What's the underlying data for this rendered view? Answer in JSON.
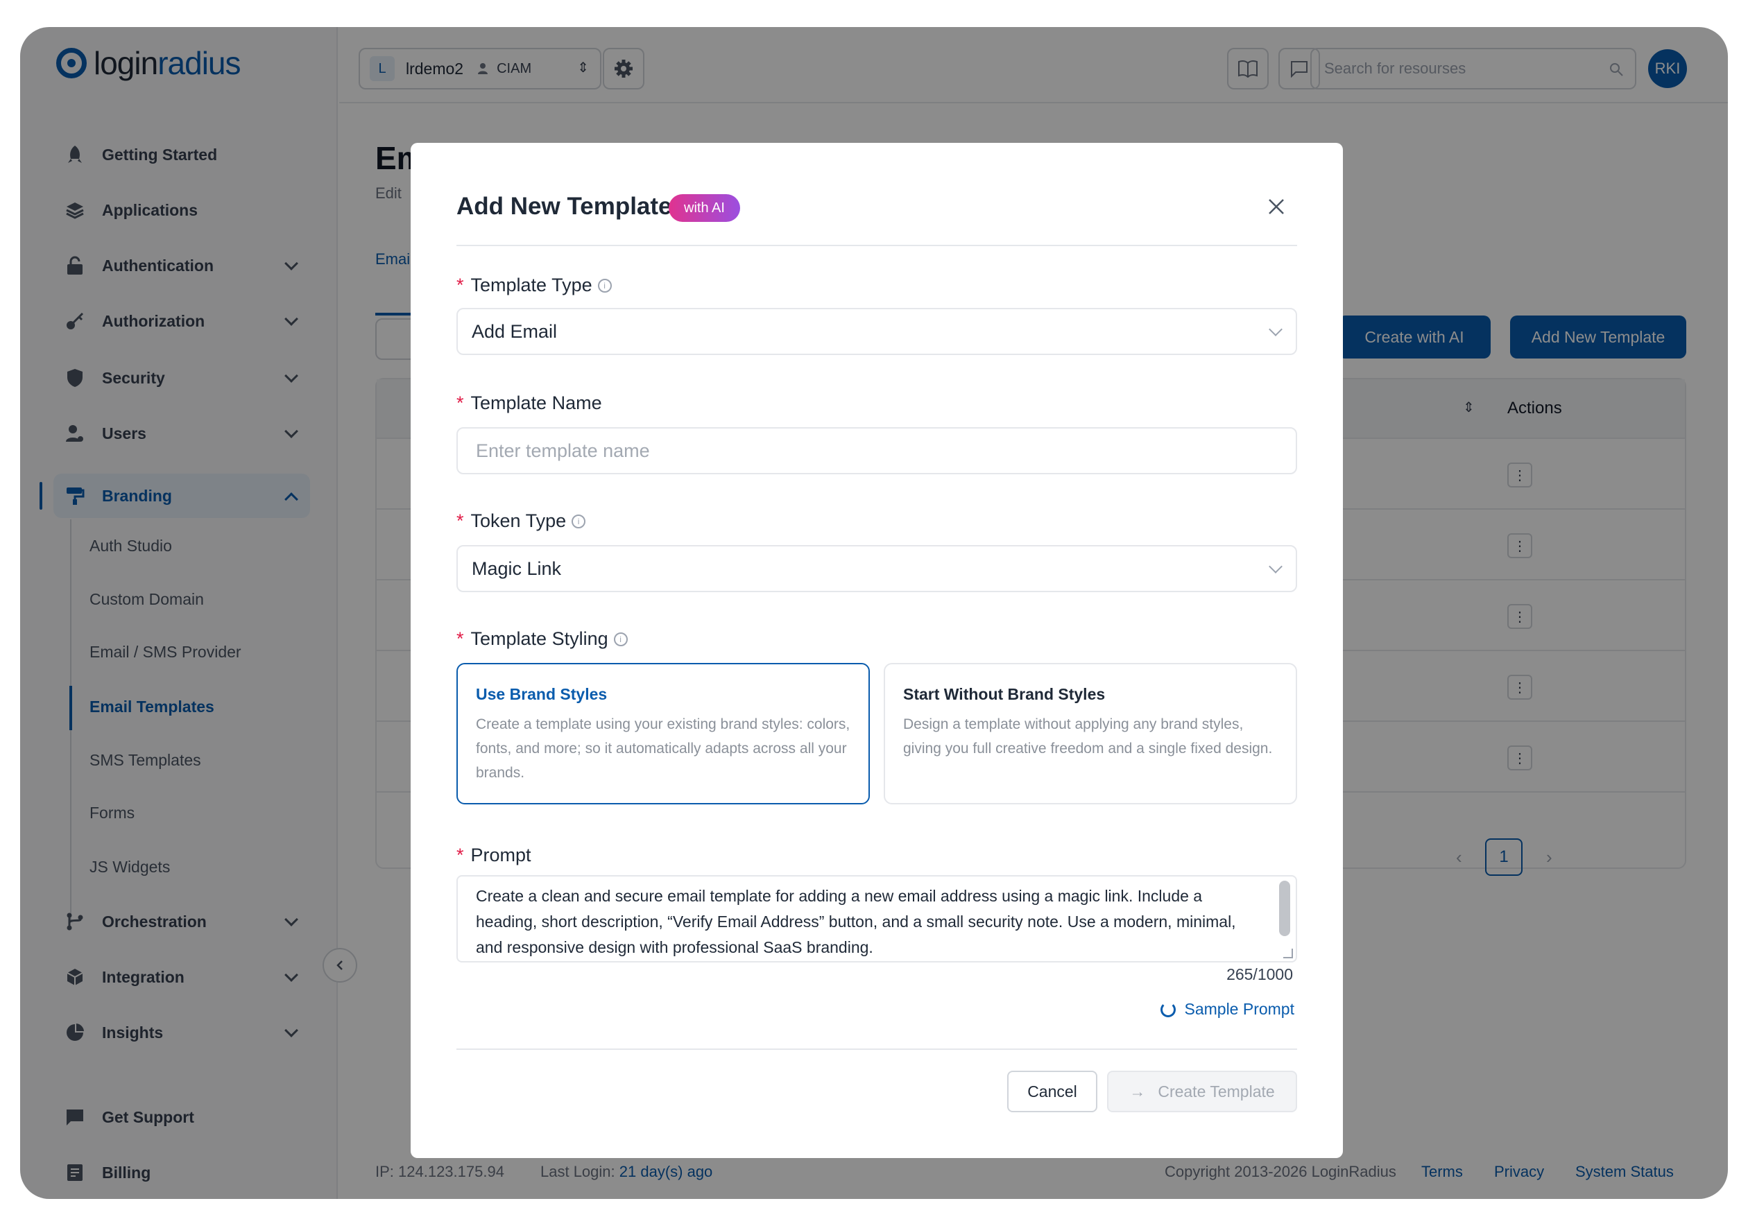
{
  "brand": {
    "logo_part1": "login",
    "logo_part2": "radius"
  },
  "sidebar": {
    "items": [
      {
        "label": "Getting Started",
        "icon": "rocket-icon"
      },
      {
        "label": "Applications",
        "icon": "layers-icon"
      },
      {
        "label": "Authentication",
        "icon": "lock-icon"
      },
      {
        "label": "Authorization",
        "icon": "key-icon"
      },
      {
        "label": "Security",
        "icon": "shield-icon"
      },
      {
        "label": "Users",
        "icon": "users-icon"
      },
      {
        "label": "Branding",
        "icon": "paint-roller-icon"
      },
      {
        "label": "Orchestration",
        "icon": "flow-icon"
      },
      {
        "label": "Integration",
        "icon": "cube-icon"
      },
      {
        "label": "Insights",
        "icon": "pie-chart-icon"
      },
      {
        "label": "Get Support",
        "icon": "chat-icon"
      },
      {
        "label": "Billing",
        "icon": "receipt-icon"
      }
    ],
    "branding_sub": [
      "Auth Studio",
      "Custom Domain",
      "Email / SMS Provider",
      "Email Templates",
      "SMS Templates",
      "Forms",
      "JS Widgets"
    ]
  },
  "topbar": {
    "env_initial": "L",
    "env_name": "lrdemo2",
    "env_role": "CIAM",
    "search_placeholder": "Search for resourses",
    "avatar": "RKI"
  },
  "page": {
    "title": "Em",
    "subtitle": "Edit",
    "tab": "Emai",
    "btn_ai": "Create with AI",
    "btn_add": "Add New Template",
    "col_actions": "Actions",
    "page_number": "1"
  },
  "footer": {
    "ip": "IP: 124.123.175.94",
    "last_login_label": "Last Login:",
    "last_login_value": "21 day(s) ago",
    "copyright": "Copyright 2013-2026 LoginRadius",
    "terms": "Terms",
    "privacy": "Privacy",
    "status": "System Status"
  },
  "modal": {
    "title": "Add New Template",
    "badge": "with AI",
    "template_type_label": "Template Type",
    "template_type_value": "Add Email",
    "template_name_label": "Template Name",
    "template_name_placeholder": "Enter template name",
    "token_type_label": "Token Type",
    "token_type_value": "Magic Link",
    "styling_label": "Template Styling",
    "card_brand_title": "Use Brand Styles",
    "card_brand_desc": "Create a template using your existing brand styles: colors, fonts, and more; so it automatically adapts across all your brands.",
    "card_nobrand_title": "Start Without Brand Styles",
    "card_nobrand_desc": "Design a template without applying any brand styles, giving you full creative freedom and a single fixed design.",
    "prompt_label": "Prompt",
    "prompt_value": "Create a clean and secure email template for adding a new email address using a magic link. Include a heading, short description, “Verify Email Address” button, and a small security note. Use a modern, minimal, and responsive design with professional SaaS branding.",
    "char_count": "265/1000",
    "sample_prompt": "Sample Prompt",
    "cancel": "Cancel",
    "create": "Create Template"
  },
  "colors": {
    "accent": "#0a5cad",
    "badge_start": "#e0338f",
    "badge_end": "#9b4fe0",
    "required": "#e11d48"
  }
}
